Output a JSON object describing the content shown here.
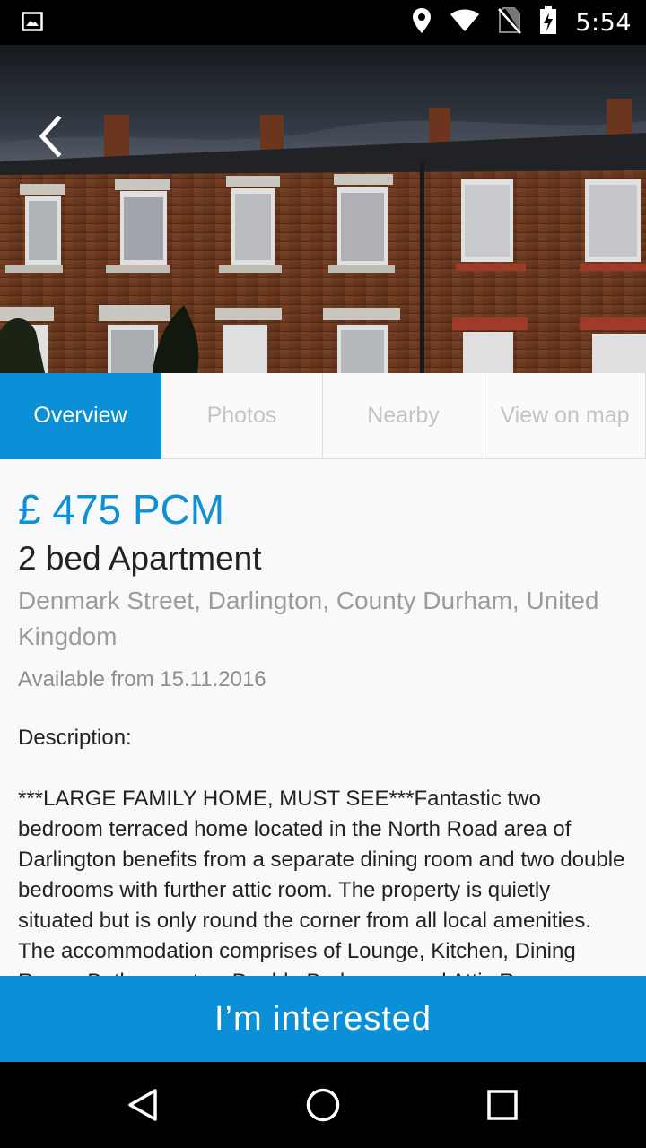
{
  "status_bar": {
    "time": "5:54",
    "icons": [
      "image-notification-icon",
      "location-icon",
      "wifi-icon",
      "no-sim-icon",
      "battery-charging-icon"
    ]
  },
  "hero": {
    "back_icon": "chevron-left-icon"
  },
  "tabs": [
    {
      "label": "Overview",
      "active": true
    },
    {
      "label": "Photos",
      "active": false
    },
    {
      "label": "Nearby",
      "active": false
    },
    {
      "label": "View on map",
      "active": false
    }
  ],
  "listing": {
    "price": "£ 475 PCM",
    "title": "2 bed Apartment",
    "address": "Denmark Street, Darlington, County Durham, United Kingdom",
    "available": "Available from 15.11.2016",
    "description_heading": "Description:",
    "description": "***LARGE FAMILY HOME, MUST SEE***Fantastic two bedroom terraced home located in the North Road area of Darlington benefits from a separate dining room and two double bedrooms with further attic room. The property is quietly situated but is only round the corner from all local amenities. The accommodation comprises of Lounge, Kitchen, Dining Room, Bathroom, two Double Bedrooms and Attic Room."
  },
  "cta": {
    "label": "I’m interested"
  },
  "colors": {
    "accent": "#0b8fd6",
    "price": "#1090d4"
  },
  "nav_bar": {
    "icons": [
      "back-triangle-icon",
      "home-circle-icon",
      "recents-square-icon"
    ]
  }
}
